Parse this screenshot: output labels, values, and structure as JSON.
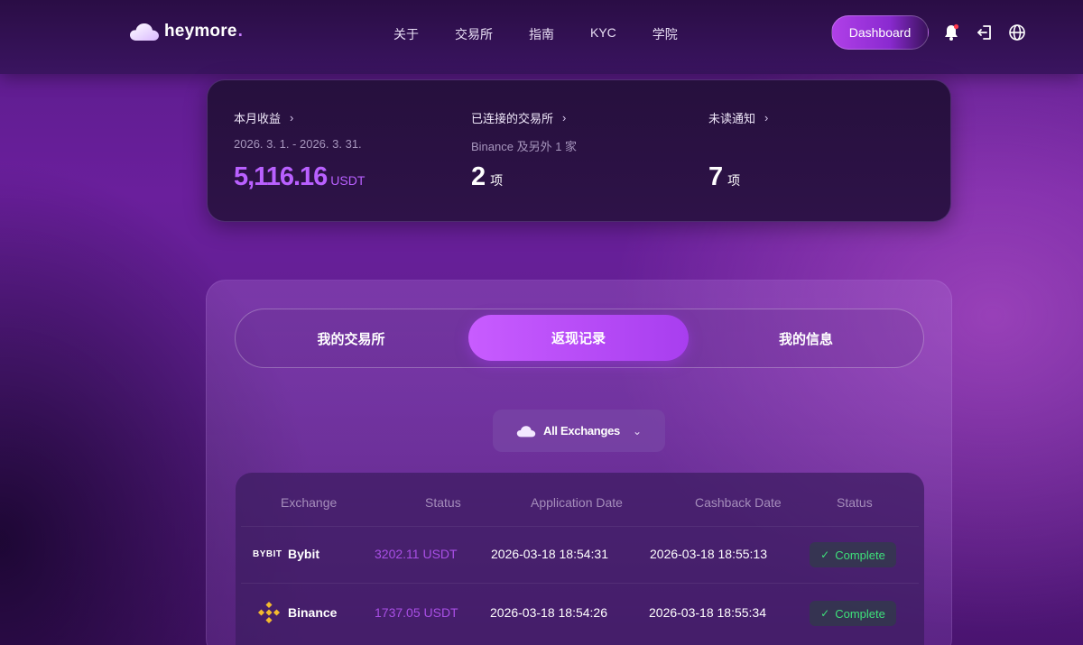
{
  "header": {
    "logo_text": "heymore",
    "logo_dot": ".",
    "nav": [
      "关于",
      "交易所",
      "指南",
      "KYC",
      "学院"
    ],
    "dashboard_label": "Dashboard"
  },
  "stats": {
    "earnings": {
      "title": "本月收益",
      "period": "2026. 3. 1. - 2026. 3. 31.",
      "value": "5,116.16",
      "unit": "USDT"
    },
    "exchanges": {
      "title": "已连接的交易所",
      "sub": "Binance 及另外 1 家",
      "value": "2",
      "unit": "项"
    },
    "notifications": {
      "title": "未读通知",
      "value": "7",
      "unit": "项"
    }
  },
  "tabs": [
    "我的交易所",
    "返现记录",
    "我的信息"
  ],
  "filter": {
    "label": "All Exchanges"
  },
  "table": {
    "headers": [
      "Exchange",
      "Status",
      "Application Date",
      "Cashback Date",
      "Status"
    ],
    "rows": [
      {
        "logo": "BYBIT",
        "exchange": "Bybit",
        "amount": "3202.11 USDT",
        "app_date": "2026-03-18 18:54:31",
        "cb_date": "2026-03-18 18:55:13",
        "status": "Complete"
      },
      {
        "exchange": "Binance",
        "amount": "1737.05 USDT",
        "app_date": "2026-03-18 18:54:26",
        "cb_date": "2026-03-18 18:55:34",
        "status": "Complete"
      }
    ]
  },
  "colors": {
    "accent": "#b960ff",
    "success": "#3ee07a",
    "binance": "#f3ba2f"
  }
}
